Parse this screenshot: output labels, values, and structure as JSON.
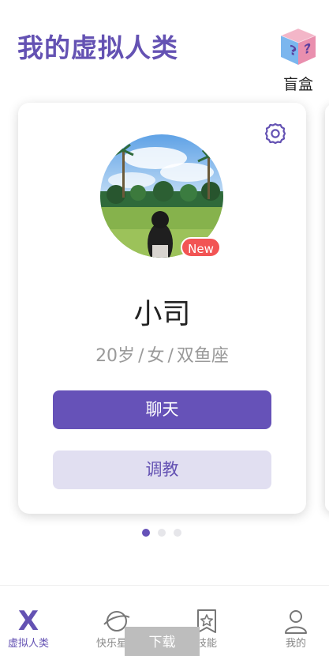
{
  "header": {
    "title": "我的虚拟人类",
    "blindbox_label": "盲盒",
    "blindbox_icon": "mystery-box-icon"
  },
  "card": {
    "badge": "New",
    "name": "小司",
    "info": {
      "age": "20岁",
      "gender": "女",
      "zodiac": "双鱼座",
      "separator": "/"
    },
    "chat_label": "聊天",
    "train_label": "调教",
    "settings_icon": "gear-icon"
  },
  "pagination": {
    "total": 3,
    "active": 1
  },
  "tabbar": {
    "items": [
      {
        "label": "虚拟人类",
        "icon": "x-logo-icon",
        "active": true
      },
      {
        "label": "快乐星球",
        "icon": "planet-icon",
        "active": false
      },
      {
        "label": "技能",
        "icon": "star-bookmark-icon",
        "active": false
      },
      {
        "label": "我的",
        "icon": "person-icon",
        "active": false
      }
    ]
  },
  "overlay": {
    "download_label": "下载"
  },
  "colors": {
    "accent": "#6652b8",
    "accent_light": "#e1dff1",
    "badge": "#f25454",
    "muted_text": "#9a9a9a"
  }
}
